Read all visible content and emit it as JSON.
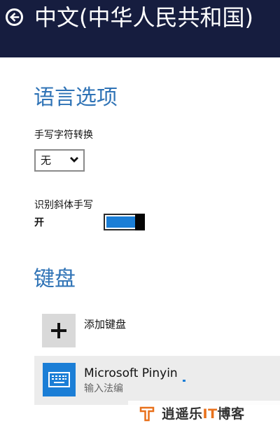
{
  "header": {
    "title": "中文(中华人民共和国)"
  },
  "language_options": {
    "title": "语言选项",
    "handwriting_conversion": {
      "label": "手写字符转换",
      "selected": "无"
    },
    "recognize_italic": {
      "label": "识别斜体手写",
      "state": "开",
      "on": true
    }
  },
  "keyboard": {
    "title": "键盘",
    "add_label": "添加键盘",
    "items": [
      {
        "name": "Microsoft Pinyin",
        "subtitle": "输入法编"
      }
    ]
  },
  "watermark": {
    "text_part1": "逍遥乐",
    "text_accent": "IT",
    "text_part2": "博客"
  },
  "colors": {
    "header_bg": "#161d3f",
    "accent": "#2f73b6",
    "toggle_blue": "#1b7ed6",
    "watermark_orange": "#e8711c"
  },
  "icons": {
    "back": "back-arrow-circle-icon",
    "chevron": "chevron-down-icon",
    "add": "plus-icon",
    "keyboard": "keyboard-icon",
    "logo": "blog-logo-icon"
  }
}
